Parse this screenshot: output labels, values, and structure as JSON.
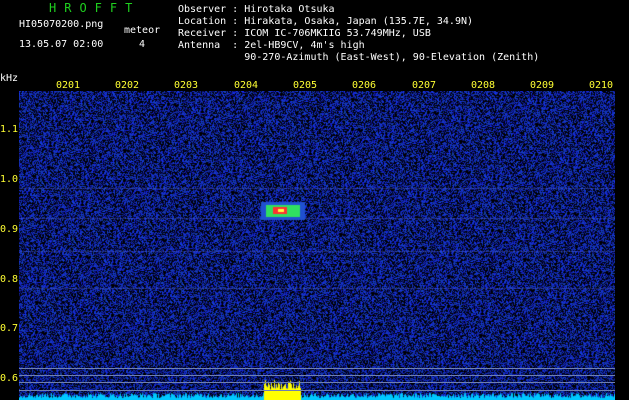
{
  "header": {
    "app_name": "HROFFT",
    "filename": "HI05070200.png",
    "datetime": "13.05.07 02:00",
    "meteor_label": "meteor",
    "meteor_count": "4",
    "observer": "Observer : Hirotaka Otsuka",
    "location": "Location : Hirakata, Osaka, Japan (135.7E, 34.9N)",
    "receiver": "Receiver : ICOM IC-706MKIIG 53.749MHz, USB",
    "antenna": "Antenna  : 2el-HB9CV, 4m's high",
    "antenna_dir": "           90-270-Azimuth (East-West), 90-Elevation (Zenith)"
  },
  "spectrogram": {
    "y_unit": "kHz",
    "x_ticks": [
      "0201",
      "0202",
      "0203",
      "0204",
      "0205",
      "0206",
      "0207",
      "0208",
      "0209",
      "0210"
    ],
    "y_ticks": [
      "1.1",
      "1.0",
      "0.9",
      "0.8",
      "0.7",
      "0.6"
    ],
    "colors": {
      "background_noise": "#1a2aa8",
      "meteor_core": "#ff3030",
      "meteor_mid": "#30e060",
      "signal_band": "#00c8ff",
      "burst": "#ffff00",
      "axis_text": "#ffff33",
      "app_title": "#1fd01f"
    }
  }
}
